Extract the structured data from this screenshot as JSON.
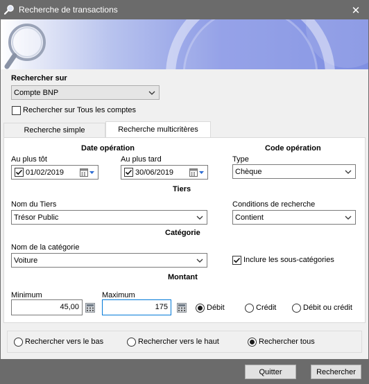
{
  "window": {
    "title": "Recherche de transactions",
    "close_glyph": "✕"
  },
  "search_on": {
    "label": "Rechercher sur",
    "selected_account": "Compte BNP",
    "all_accounts_label": "Rechercher sur Tous les comptes",
    "all_accounts_checked": false
  },
  "tabs": [
    {
      "label": "Recherche simple",
      "active": false
    },
    {
      "label": "Recherche multicritères",
      "active": true
    }
  ],
  "date_operation": {
    "heading": "Date opération",
    "earliest_label": "Au plus tôt",
    "earliest_value": "01/02/2019",
    "earliest_checked": true,
    "latest_label": "Au plus tard",
    "latest_value": "30/06/2019",
    "latest_checked": true
  },
  "code_operation": {
    "heading": "Code opération",
    "type_label": "Type",
    "type_value": "Chèque"
  },
  "tiers": {
    "heading": "Tiers",
    "name_label": "Nom du Tiers",
    "name_value": "Trésor Public",
    "conditions_label": "Conditions de recherche",
    "conditions_value": "Contient"
  },
  "categorie": {
    "heading": "Catégorie",
    "name_label": "Nom de la catégorie",
    "name_value": "Voiture",
    "include_sub_label": "Inclure les sous-catégories",
    "include_sub_checked": true
  },
  "montant": {
    "heading": "Montant",
    "min_label": "Minimum",
    "min_value": "45,00",
    "max_label": "Maximum",
    "max_value": "175",
    "options": [
      {
        "label": "Débit",
        "selected": true
      },
      {
        "label": "Crédit",
        "selected": false
      },
      {
        "label": "Débit ou crédit",
        "selected": false
      }
    ]
  },
  "direction": {
    "options": [
      {
        "label": "Rechercher vers le bas",
        "selected": false
      },
      {
        "label": "Rechercher vers le haut",
        "selected": false
      },
      {
        "label": "Rechercher tous",
        "selected": true
      }
    ]
  },
  "buttons": {
    "quit": "Quitter",
    "search": "Rechercher"
  },
  "icons": {
    "window": "magnifier-icon",
    "banner": "magnifier-icon",
    "dropdown": "chevron-down-icon",
    "calendar": "calendar-icon",
    "calculator": "calculator-icon",
    "check": "checkmark-icon"
  },
  "colors": {
    "titlebar": "#6b6b6b",
    "banner_blue": "#7f8fe2",
    "focus_border": "#0078d7"
  }
}
